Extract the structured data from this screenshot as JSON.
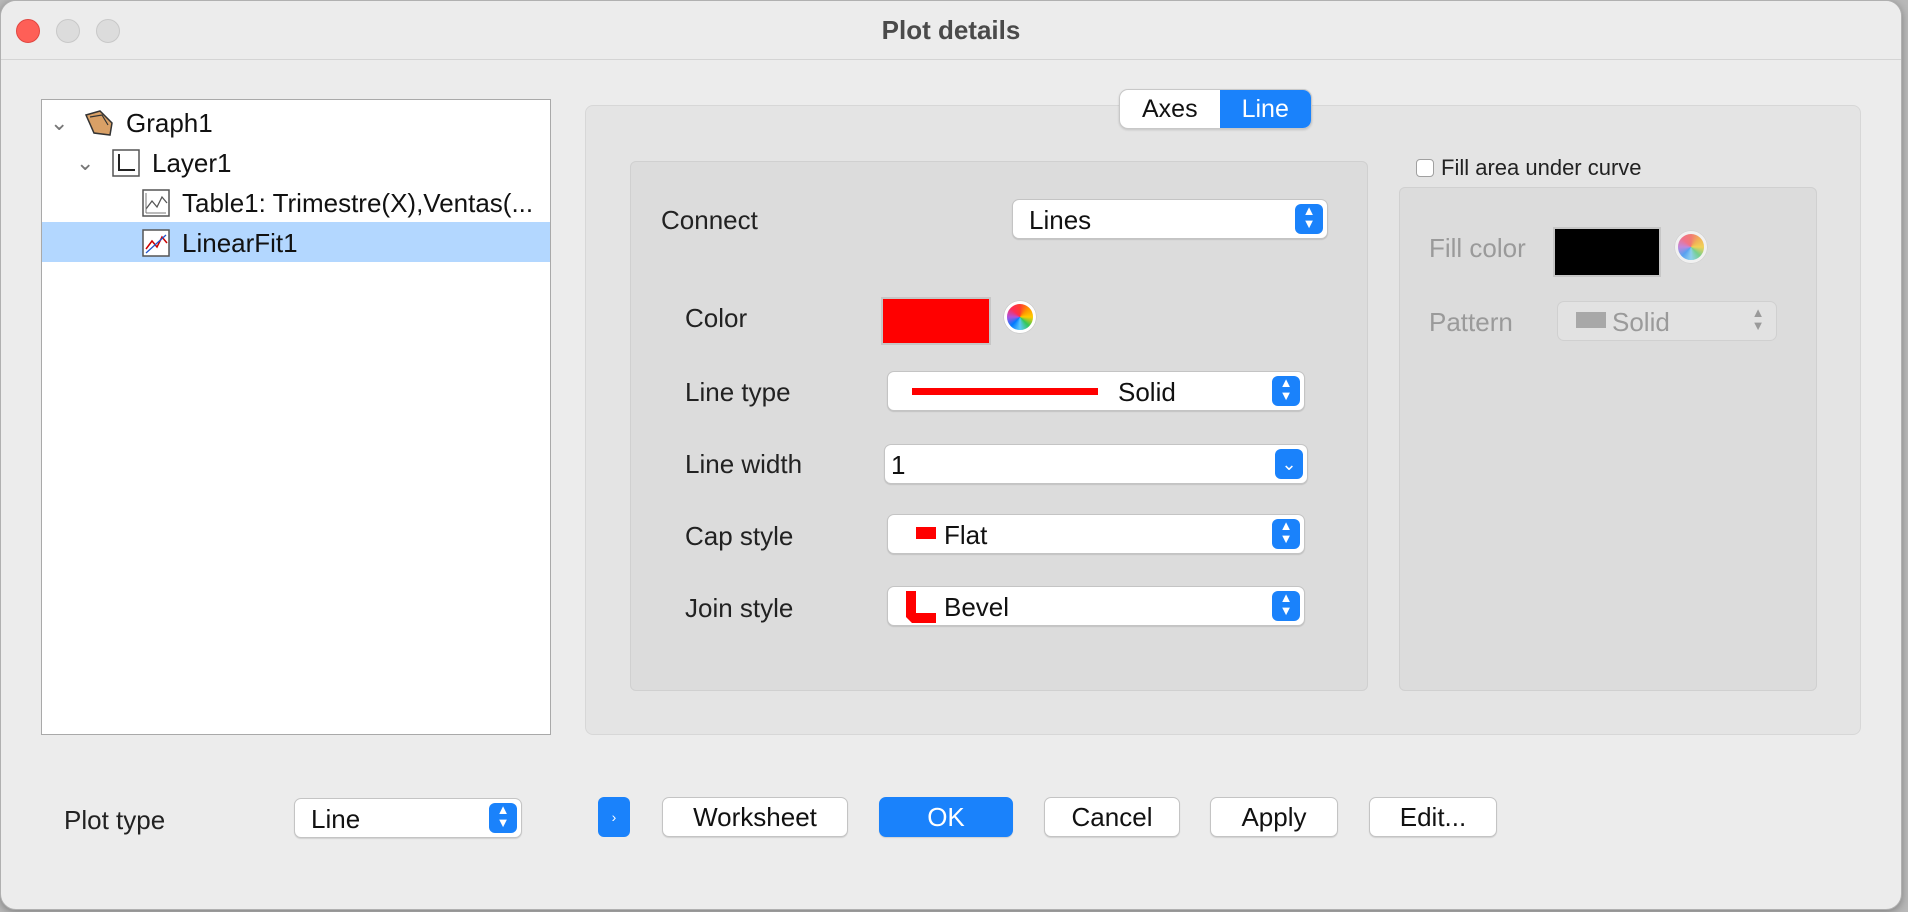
{
  "window": {
    "title": "Plot details"
  },
  "tree": {
    "items": [
      {
        "label": "Graph1"
      },
      {
        "label": "Layer1"
      },
      {
        "label": "Table1: Trimestre(X),Ventas(..."
      },
      {
        "label": "LinearFit1",
        "selected": true
      }
    ]
  },
  "tabs": [
    {
      "label": "Axes"
    },
    {
      "label": "Line",
      "active": true
    }
  ],
  "line": {
    "connect_label": "Connect",
    "connect_value": "Lines",
    "color_label": "Color",
    "color_value": "#ff0000",
    "line_type_label": "Line type",
    "line_type_value": "Solid",
    "line_width_label": "Line width",
    "line_width_value": "1",
    "cap_style_label": "Cap style",
    "cap_style_value": "Flat",
    "join_style_label": "Join style",
    "join_style_value": "Bevel"
  },
  "fill": {
    "checkbox_label": "Fill area under curve",
    "checked": false,
    "fill_color_label": "Fill color",
    "fill_color_value": "#000000",
    "pattern_label": "Pattern",
    "pattern_value": "Solid"
  },
  "footer": {
    "plot_type_label": "Plot type",
    "plot_type_value": "Line",
    "worksheet_button": "Worksheet",
    "ok_button": "OK",
    "cancel_button": "Cancel",
    "apply_button": "Apply",
    "edit_button": "Edit..."
  },
  "icons": [
    "chevron-down-icon",
    "graph-icon",
    "layer-icon",
    "table-plot-icon",
    "fit-plot-icon",
    "color-wheel-icon",
    "stepper-icon"
  ]
}
